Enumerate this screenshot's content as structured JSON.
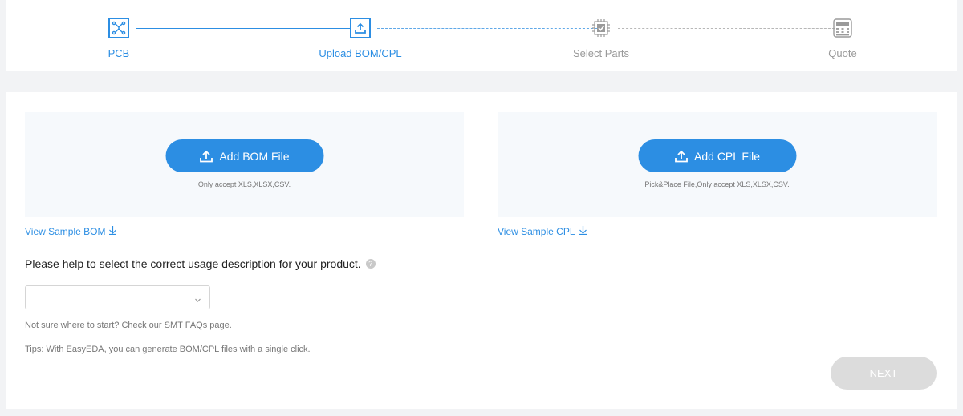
{
  "stepper": {
    "steps": [
      {
        "label": "PCB",
        "icon": "circuit-board-icon",
        "state": "done"
      },
      {
        "label": "Upload BOM/CPL",
        "icon": "upload-icon",
        "state": "active"
      },
      {
        "label": "Select Parts",
        "icon": "chip-check-icon",
        "state": "pending"
      },
      {
        "label": "Quote",
        "icon": "calculator-icon",
        "state": "pending"
      }
    ]
  },
  "bom": {
    "button_label": "Add BOM File",
    "note": "Only accept XLS,XLSX,CSV.",
    "sample_link": "View Sample BOM"
  },
  "cpl": {
    "button_label": "Add CPL File",
    "note": "Pick&Place File,Only accept XLS,XLSX,CSV.",
    "sample_link": "View Sample CPL"
  },
  "usage": {
    "question": "Please help to select the correct usage description for your product.",
    "help_glyph": "?",
    "selected_value": ""
  },
  "faq": {
    "prefix": "Not sure where to start? Check our ",
    "link": "SMT FAQs page",
    "suffix": "."
  },
  "tips": "Tips: With EasyEDA, you can generate BOM/CPL files with a single click.",
  "next_label": "NEXT",
  "colors": {
    "accent": "#2c8ee3",
    "disabled": "#dcdcdc",
    "pending": "#9a9a9a"
  }
}
